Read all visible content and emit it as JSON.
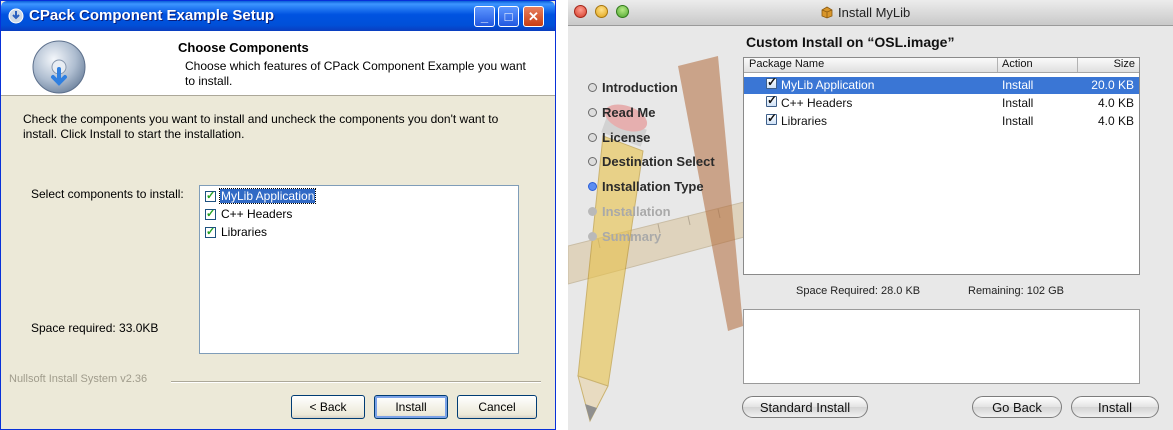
{
  "windows_installer": {
    "title": "CPack Component Example Setup",
    "header": {
      "title": "Choose Components",
      "subtitle": "Choose which features of CPack Component Example you want to install."
    },
    "instructions": "Check the components you want to install and uncheck the components you don't want to install. Click Install to start the installation.",
    "select_label": "Select components to install:",
    "components": [
      {
        "label": "MyLib Application",
        "checked": true,
        "selected": true
      },
      {
        "label": "C++ Headers",
        "checked": true,
        "selected": false
      },
      {
        "label": "Libraries",
        "checked": true,
        "selected": false
      }
    ],
    "space_required": "Space required: 33.0KB",
    "footer_brand": "Nullsoft Install System v2.36",
    "buttons": {
      "back": "< Back",
      "install": "Install",
      "cancel": "Cancel"
    },
    "title_buttons": {
      "minimize": "_",
      "maximize": "□",
      "close": "✕"
    }
  },
  "mac_installer": {
    "title": "Install MyLib",
    "steps": [
      {
        "label": "Introduction",
        "state": "done"
      },
      {
        "label": "Read Me",
        "state": "done"
      },
      {
        "label": "License",
        "state": "done"
      },
      {
        "label": "Destination Select",
        "state": "done"
      },
      {
        "label": "Installation Type",
        "state": "active"
      },
      {
        "label": "Installation",
        "state": "future"
      },
      {
        "label": "Summary",
        "state": "future"
      }
    ],
    "heading": "Custom Install on “OSL.image”",
    "table": {
      "columns": [
        "Package Name",
        "Action",
        "Size"
      ],
      "rows": [
        {
          "name": "MyLib Application",
          "action": "Install",
          "size": "20.0 KB",
          "checked": true,
          "selected": true
        },
        {
          "name": "C++ Headers",
          "action": "Install",
          "size": "4.0 KB",
          "checked": true,
          "selected": false
        },
        {
          "name": "Libraries",
          "action": "Install",
          "size": "4.0 KB",
          "checked": true,
          "selected": false
        }
      ]
    },
    "space_required": "Space Required:  28.0 KB",
    "remaining": "Remaining:  102 GB",
    "buttons": {
      "standard": "Standard Install",
      "go_back": "Go Back",
      "install": "Install"
    }
  },
  "colors": {
    "xp_title_blue": "#0053e1",
    "xp_selection": "#316ac5",
    "mac_selection": "#3a76d5",
    "mac_active_step": "#5b8df2"
  }
}
